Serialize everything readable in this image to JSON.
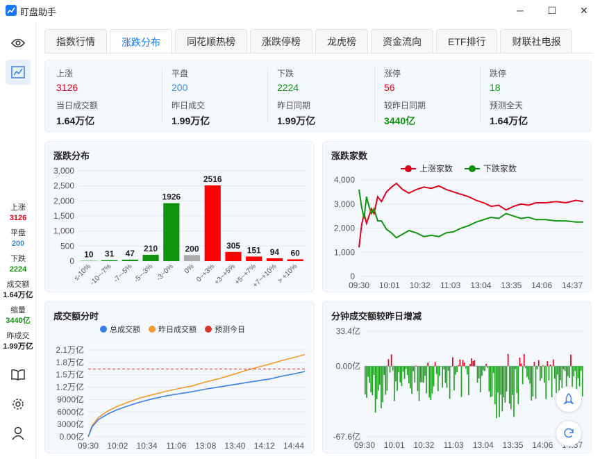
{
  "app": {
    "title": "盯盘助手"
  },
  "window": {
    "minimize": "─",
    "maximize": "☐",
    "close": "✕"
  },
  "tabs": [
    "指数行情",
    "涨跌分布",
    "同花顺热榜",
    "涨跌停榜",
    "龙虎榜",
    "资金流向",
    "ETF排行",
    "财联社电报"
  ],
  "active_tab": 1,
  "sidebar": {
    "stats": [
      {
        "label": "上涨",
        "value": "3126",
        "color": "#e0001b"
      },
      {
        "label": "平盘",
        "value": "200",
        "color": "#3a8be0"
      },
      {
        "label": "下跌",
        "value": "2224",
        "color": "#109410"
      },
      {
        "label": "成交额",
        "value": "1.64万亿",
        "color": "#222222"
      },
      {
        "label": "缩量",
        "value": "3440亿",
        "color": "#109410"
      },
      {
        "label": "昨成交",
        "value": "1.99万亿",
        "color": "#222222"
      }
    ]
  },
  "summary": {
    "row1": [
      {
        "label": "上涨",
        "value": "3126",
        "color": "#e0001b"
      },
      {
        "label": "平盘",
        "value": "200",
        "color": "#3a8be0"
      },
      {
        "label": "下跌",
        "value": "2224",
        "color": "#109410"
      },
      {
        "label": "涨停",
        "value": "56",
        "color": "#e0001b"
      },
      {
        "label": "跌停",
        "value": "18",
        "color": "#109410"
      }
    ],
    "row2": [
      {
        "label": "当日成交额",
        "value": "1.64万亿",
        "color": "#222222"
      },
      {
        "label": "昨日成交",
        "value": "1.99万亿",
        "color": "#222222"
      },
      {
        "label": "昨日同期",
        "value": "1.99万亿",
        "color": "#222222"
      },
      {
        "label": "较昨日同期",
        "value": "3440亿",
        "color": "#109410"
      },
      {
        "label": "预测全天",
        "value": "1.64万亿",
        "color": "#222222"
      }
    ]
  },
  "chart_data": [
    {
      "type": "bar",
      "title": "涨跌分布",
      "categories": [
        "≤-10%",
        "-10~-7%",
        "-7~-5%",
        "-5~-3%",
        "-3~0%",
        "0%",
        "0~+3%",
        "+3~+5%",
        "+5~+7%",
        "+7~+10%",
        "> +10%"
      ],
      "values": [
        10,
        31,
        47,
        210,
        1926,
        200,
        2516,
        305,
        151,
        94,
        60
      ],
      "colors": [
        "#109410",
        "#109410",
        "#109410",
        "#109410",
        "#109410",
        "#aaaaaa",
        "#ff0000",
        "#ff0000",
        "#ff0000",
        "#ff0000",
        "#ff0000"
      ],
      "yticks": [
        "0",
        "500",
        "1,000",
        "1,500",
        "2,000",
        "2,500",
        "3,000"
      ],
      "ylim": [
        0,
        3000
      ]
    },
    {
      "type": "line",
      "title": "涨跌家数",
      "series": [
        {
          "name": "上涨家数",
          "color": "#e0001b"
        },
        {
          "name": "下跌家数",
          "color": "#109410"
        }
      ],
      "xticks": [
        "09:30",
        "10:01",
        "10:32",
        "11:03",
        "13:04",
        "13:35",
        "14:06",
        "14:37"
      ],
      "yticks": [
        "0",
        "1,000",
        "2,000",
        "3,000",
        "4,000"
      ],
      "ylim": [
        0,
        4000
      ],
      "up": [
        [
          0,
          1200
        ],
        [
          2,
          2100
        ],
        [
          4,
          2600
        ],
        [
          6,
          2200
        ],
        [
          8,
          2500
        ],
        [
          10,
          2800
        ],
        [
          12,
          2600
        ],
        [
          15,
          3300
        ],
        [
          18,
          3100
        ],
        [
          22,
          3500
        ],
        [
          26,
          3700
        ],
        [
          30,
          3850
        ],
        [
          35,
          3600
        ],
        [
          40,
          3450
        ],
        [
          46,
          3600
        ],
        [
          52,
          3700
        ],
        [
          58,
          3650
        ],
        [
          64,
          3750
        ],
        [
          70,
          3600
        ],
        [
          76,
          3500
        ],
        [
          82,
          3400
        ],
        [
          88,
          3300
        ],
        [
          94,
          3150
        ],
        [
          100,
          3050
        ],
        [
          106,
          2900
        ],
        [
          112,
          2950
        ],
        [
          118,
          2750
        ],
        [
          124,
          2900
        ],
        [
          130,
          3000
        ],
        [
          136,
          2950
        ],
        [
          142,
          3050
        ],
        [
          150,
          3050
        ],
        [
          158,
          3100
        ],
        [
          166,
          3050
        ],
        [
          174,
          3150
        ],
        [
          180,
          3100
        ]
      ],
      "down": [
        [
          0,
          3600
        ],
        [
          2,
          2900
        ],
        [
          4,
          2400
        ],
        [
          6,
          3300
        ],
        [
          8,
          2900
        ],
        [
          10,
          2600
        ],
        [
          12,
          2800
        ],
        [
          15,
          2300
        ],
        [
          18,
          2300
        ],
        [
          22,
          1950
        ],
        [
          26,
          1800
        ],
        [
          30,
          1600
        ],
        [
          35,
          1750
        ],
        [
          40,
          1900
        ],
        [
          46,
          1800
        ],
        [
          52,
          1650
        ],
        [
          58,
          1700
        ],
        [
          64,
          1650
        ],
        [
          70,
          1800
        ],
        [
          76,
          1850
        ],
        [
          82,
          2000
        ],
        [
          88,
          2100
        ],
        [
          94,
          2250
        ],
        [
          100,
          2350
        ],
        [
          106,
          2450
        ],
        [
          112,
          2400
        ],
        [
          118,
          2600
        ],
        [
          124,
          2500
        ],
        [
          130,
          2400
        ],
        [
          136,
          2450
        ],
        [
          142,
          2350
        ],
        [
          150,
          2350
        ],
        [
          158,
          2300
        ],
        [
          166,
          2300
        ],
        [
          174,
          2250
        ],
        [
          180,
          2250
        ]
      ]
    },
    {
      "type": "line",
      "title": "成交额分时",
      "series": [
        {
          "name": "总成交额",
          "color": "#3a7fe6"
        },
        {
          "name": "昨日成交额",
          "color": "#f29a2e"
        },
        {
          "name": "预测今日",
          "color": "#dd3333"
        }
      ],
      "xticks": [
        "09:30",
        "10:02",
        "10:34",
        "11:06",
        "13:08",
        "13:40",
        "14:12",
        "14:44"
      ],
      "yticks": [
        "0.00亿",
        "3000亿",
        "6000亿",
        "9000亿",
        "1.2万亿",
        "1.5万亿",
        "1.8万亿",
        "2.1万亿"
      ],
      "ylim": [
        0,
        21000
      ],
      "forecast": 16400,
      "today": [
        [
          0,
          0
        ],
        [
          3,
          2400
        ],
        [
          8,
          4200
        ],
        [
          15,
          5500
        ],
        [
          22,
          6500
        ],
        [
          30,
          7400
        ],
        [
          40,
          8400
        ],
        [
          50,
          9200
        ],
        [
          60,
          9900
        ],
        [
          70,
          10400
        ],
        [
          80,
          10900
        ],
        [
          90,
          11500
        ],
        [
          100,
          12000
        ],
        [
          110,
          12500
        ],
        [
          120,
          13000
        ],
        [
          130,
          13500
        ],
        [
          140,
          14000
        ],
        [
          150,
          14700
        ],
        [
          160,
          15300
        ],
        [
          167,
          15800
        ]
      ],
      "yesterday": [
        [
          0,
          0
        ],
        [
          3,
          2700
        ],
        [
          8,
          4700
        ],
        [
          15,
          6200
        ],
        [
          22,
          7300
        ],
        [
          30,
          8300
        ],
        [
          40,
          9400
        ],
        [
          50,
          10200
        ],
        [
          60,
          11000
        ],
        [
          70,
          11700
        ],
        [
          80,
          12300
        ],
        [
          90,
          13200
        ],
        [
          100,
          14000
        ],
        [
          110,
          14900
        ],
        [
          120,
          15900
        ],
        [
          130,
          16800
        ],
        [
          140,
          17600
        ],
        [
          150,
          18500
        ],
        [
          160,
          19300
        ],
        [
          167,
          19900
        ]
      ]
    },
    {
      "type": "bar",
      "title": "分钟成交额较昨日增减",
      "xticks": [
        "09:30",
        "10:01",
        "10:32",
        "11:03",
        "13:04",
        "13:35",
        "14:06",
        "14:37"
      ],
      "yticks": [
        "33.4亿",
        "0.00亿",
        "-67.6亿"
      ],
      "ylim": [
        -67.6,
        33.4
      ]
    }
  ]
}
